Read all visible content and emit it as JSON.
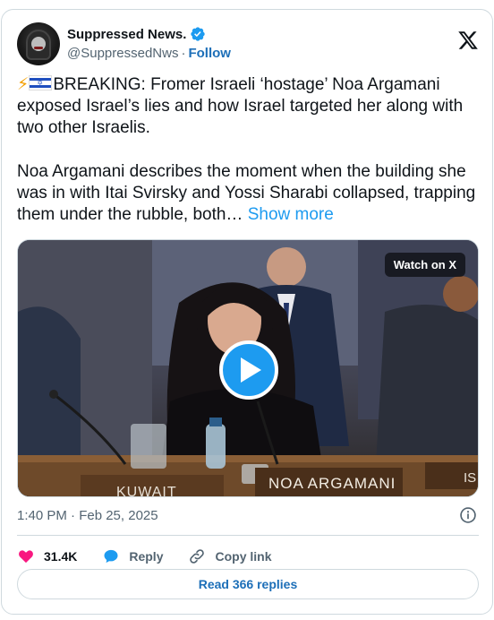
{
  "author": {
    "name": "Suppressed News.",
    "handle": "@SuppressedNws",
    "separator": "·",
    "follow_label": "Follow",
    "avatar_icon": "hooded-figure-avatar",
    "verified_icon": "verified-badge-icon"
  },
  "platform_icon": "x-logo-icon",
  "tweet": {
    "bolt": "⚡",
    "line1_rest": "BREAKING: Fromer Israeli ‘hostage’ Noa Argamani exposed Israel’s lies and how Israel targeted her along with two other Israelis.",
    "paragraph2": "Noa Argamani describes the moment when the building she was in with Itai Svirsky and Yossi Sharabi collapsed, trapping them under the rubble, both…",
    "show_more": "Show more"
  },
  "media": {
    "watch_label": "Watch on X",
    "nameplate_main": "NOA ARGAMANI",
    "nameplate_left": "KUWAIT",
    "nameplate_right": "IS"
  },
  "timestamp": "1:40 PM · Feb 25, 2025",
  "actions": {
    "likes": "31.4K",
    "reply": "Reply",
    "copy_link": "Copy link"
  },
  "read_replies": "Read 366 replies",
  "colors": {
    "accent": "#1d9bf0",
    "link": "#1d6fb8",
    "like": "#f91880",
    "muted": "#536471"
  }
}
